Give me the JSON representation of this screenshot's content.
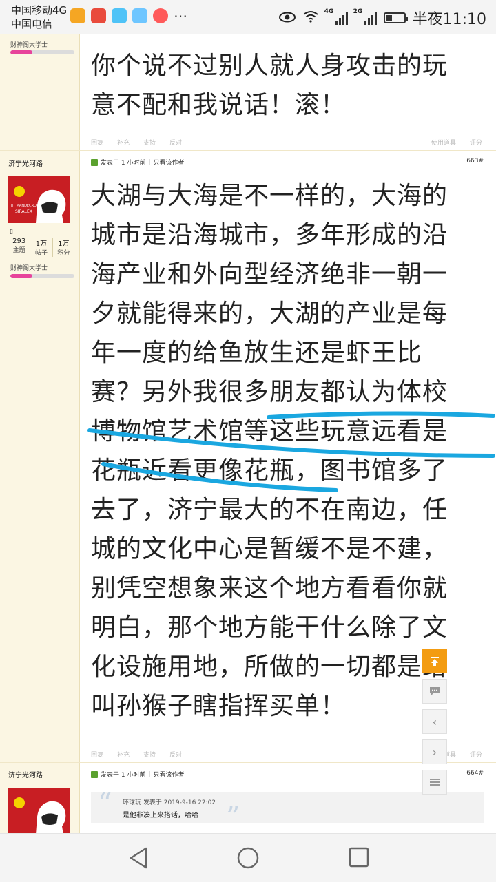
{
  "status_bar": {
    "carrier1": "中国移动4G",
    "carrier2": "中国电信",
    "time": "半夜11:10",
    "network1": "4G",
    "network2": "2G"
  },
  "posts": [
    {
      "rank": "财神阁大学士",
      "body": [
        "你个说不过别人就人身攻击的玩",
        "意不配和我说话！滚！"
      ],
      "actions": [
        "回复",
        "补充",
        "支持",
        "反对"
      ],
      "actions_right": [
        "使用道具",
        "评分"
      ]
    },
    {
      "username": "济宁光河路",
      "posted": "发表于 1 小时前",
      "only_author": "只看该作者",
      "floor": "663#",
      "stats": [
        {
          "value": "293",
          "label": "主题"
        },
        {
          "value": "1万",
          "label": "帖子"
        },
        {
          "value": "1万",
          "label": "积分"
        }
      ],
      "rank": "财神阁大学士",
      "body": [
        "大湖与大海是不一样的，大海的",
        "城市是沿海城市，多年形成的沿",
        "海产业和外向型经济绝非一朝一",
        "夕就能得来的，大湖的产业是每",
        "年一度的给鱼放生还是虾王比",
        "赛？另外我很多朋友都认为体校",
        "博物馆艺术馆等这些玩意远看是",
        "花瓶近看更像花瓶，图书馆多了",
        "去了，济宁最大的不在南边，任",
        "城的文化中心是暂缓不是不建，",
        "别凭空想象来这个地方看看你就",
        "明白，那个地方能干什么除了文",
        "化设施用地，所做的一切都是给",
        "叫孙猴子瞎指挥买单！"
      ],
      "actions": [
        "回复",
        "补充",
        "支持",
        "反对"
      ],
      "actions_right": [
        "使用道具",
        "评分"
      ]
    },
    {
      "username": "济宁光河路",
      "posted": "发表于 1 小时前",
      "only_author": "只看该作者",
      "floor": "664#",
      "quote_header": "环球玩 发表于 2019-9-16 22:02",
      "quote_text": "是他非凑上来搭话，哈哈"
    }
  ],
  "avatar_caption": [
    "JIT MANDECRO",
    "SIRALEX"
  ],
  "progress_fraction": 0.34,
  "floating_buttons": [
    "back-to-top-icon",
    "comment-icon",
    "prev-icon",
    "next-icon",
    "list-icon"
  ],
  "nav": [
    "back-icon",
    "home-icon",
    "recents-icon"
  ],
  "colors": {
    "sidebar_bg": "#fbf6e3",
    "progress": "#e7449b",
    "highlight_stroke": "#1aa7e0",
    "top_button": "#f39c12",
    "avatar_red": "#c81e23"
  }
}
